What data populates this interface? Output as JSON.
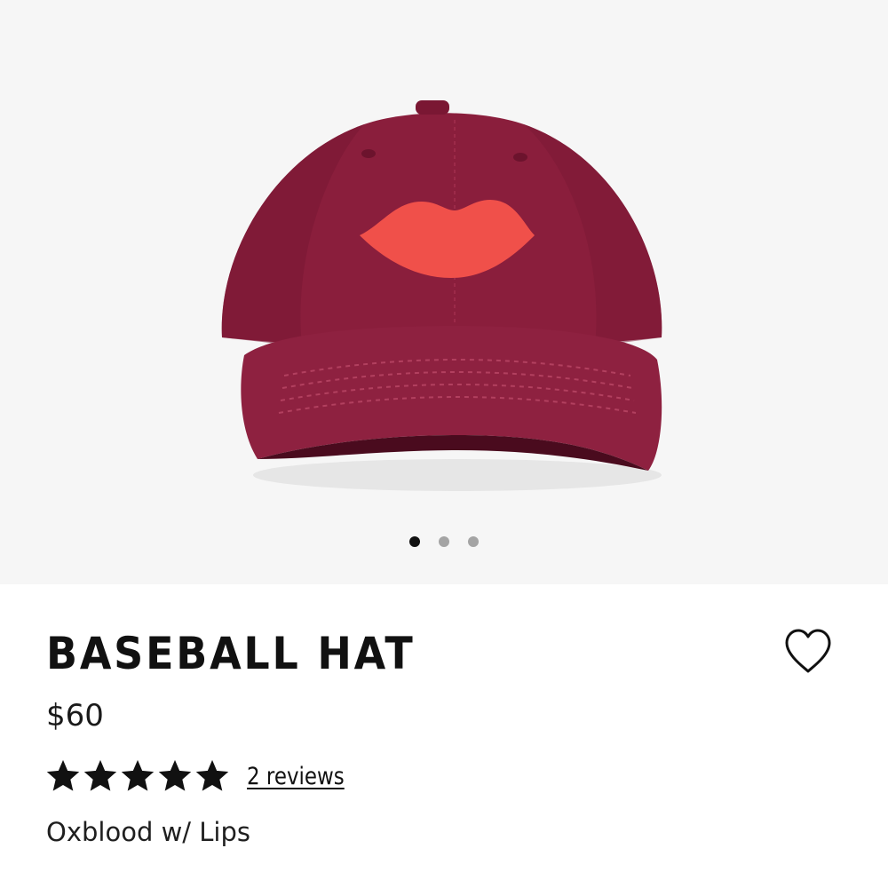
{
  "product": {
    "title": "BASEBALL HAT",
    "price": "$60",
    "variant": "Oxblood w/ Lips",
    "rating_stars": 5,
    "rating_max": 5,
    "reviews_label": "2 reviews"
  },
  "gallery": {
    "image_alt": "Oxblood baseball hat with red lips print",
    "slide_count": 3,
    "active_slide": 1
  },
  "icons": {
    "wishlist": "heart-outline-icon",
    "star": "star-filled-icon"
  },
  "colors": {
    "hat": "#8a1e3c",
    "lips": "#f0504a",
    "gallery_bg": "#f6f6f6",
    "dot_active": "#111111",
    "dot_inactive": "#a4a4a4",
    "text": "#111111"
  }
}
